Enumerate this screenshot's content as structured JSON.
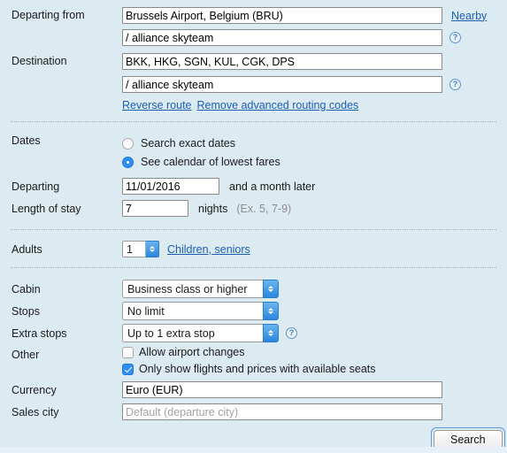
{
  "form": {
    "departing_from": {
      "label": "Departing from",
      "value": "Brussels Airport, Belgium (BRU)",
      "nearby_link": "Nearby",
      "routing_code": "/ alliance skyteam",
      "help_icon": "help-icon"
    },
    "destination": {
      "label": "Destination",
      "value": "BKK, HKG, SGN, KUL, CGK, DPS",
      "routing_code": "/ alliance skyteam",
      "help_icon": "help-icon"
    },
    "route_links": {
      "reverse": "Reverse route",
      "remove_codes": "Remove advanced routing codes"
    },
    "dates": {
      "label": "Dates",
      "options": [
        {
          "label": "Search exact dates",
          "selected": false
        },
        {
          "label": "See calendar of lowest fares",
          "selected": true
        }
      ]
    },
    "departing": {
      "label": "Departing",
      "value": "11/01/2016",
      "suffix": "and a month later"
    },
    "length_of_stay": {
      "label": "Length of stay",
      "value": "7",
      "unit": "nights",
      "hint": "(Ex. 5, 7-9)"
    },
    "adults": {
      "label": "Adults",
      "value": "1",
      "link": "Children, seniors"
    },
    "cabin": {
      "label": "Cabin",
      "value": "Business class or higher"
    },
    "stops": {
      "label": "Stops",
      "value": "No limit"
    },
    "extra_stops": {
      "label": "Extra stops",
      "value": "Up to 1 extra stop",
      "help_icon": "help-icon"
    },
    "other": {
      "label": "Other",
      "options": [
        {
          "label": "Allow airport changes",
          "checked": false
        },
        {
          "label": "Only show flights and prices with available seats",
          "checked": true
        }
      ]
    },
    "currency": {
      "label": "Currency",
      "value": "Euro (EUR)"
    },
    "sales_city": {
      "label": "Sales city",
      "placeholder": "Default (departure city)",
      "value": ""
    },
    "search_button": "Search"
  },
  "colors": {
    "background": "#dceaf2",
    "link": "#1b5fb0",
    "accent": "#2f8ff0",
    "muted_text": "#8d8d8d"
  }
}
